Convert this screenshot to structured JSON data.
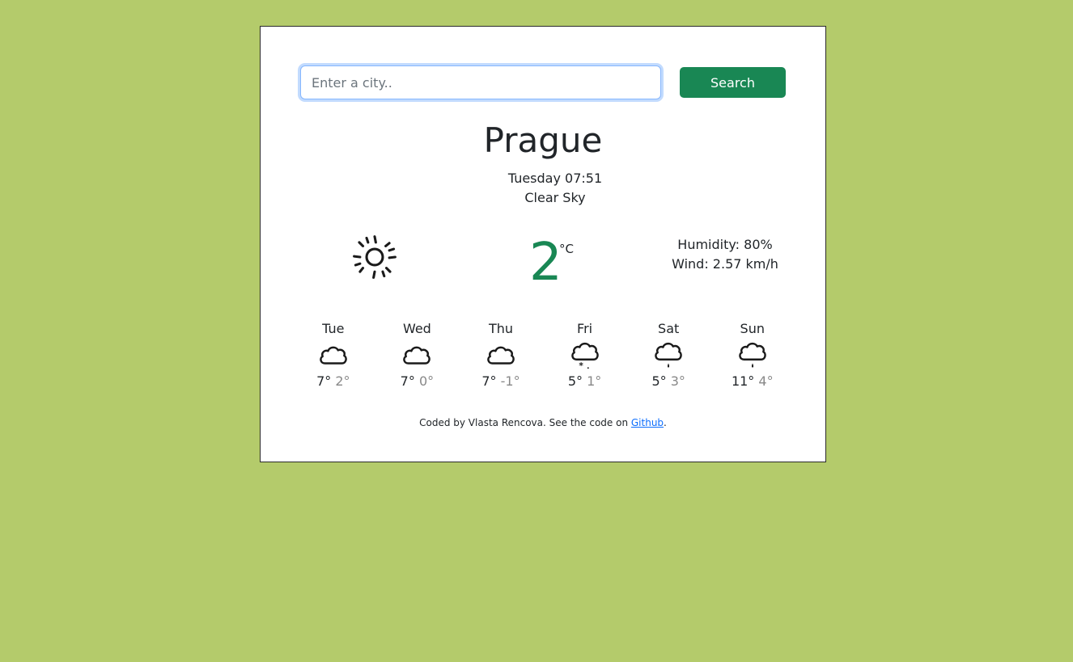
{
  "search": {
    "placeholder": "Enter a city..",
    "value": "",
    "button_label": "Search"
  },
  "current": {
    "city": "Prague",
    "datetime": "Tuesday 07:51",
    "description": "Clear Sky",
    "icon": "sun-icon",
    "temperature": "2",
    "unit": "°C",
    "humidity": "Humidity: 80%",
    "wind": "Wind: 2.57 km/h"
  },
  "forecast": [
    {
      "day": "Tue",
      "icon": "cloud-icon",
      "max": "7°",
      "min": "2°"
    },
    {
      "day": "Wed",
      "icon": "cloud-icon",
      "max": "7°",
      "min": "0°"
    },
    {
      "day": "Thu",
      "icon": "cloud-icon",
      "max": "7°",
      "min": "-1°"
    },
    {
      "day": "Fri",
      "icon": "cloud-snow-icon",
      "max": "5°",
      "min": "1°"
    },
    {
      "day": "Sat",
      "icon": "cloud-rain-icon",
      "max": "5°",
      "min": "3°"
    },
    {
      "day": "Sun",
      "icon": "cloud-rain-icon",
      "max": "11°",
      "min": "4°"
    }
  ],
  "footer": {
    "prefix": "Coded by Vlasta Rencova. See the code on ",
    "link_label": "Github",
    "suffix": "."
  },
  "colors": {
    "page_background": "#b4cb6b",
    "accent": "#198754",
    "min_temp": "#888888"
  }
}
